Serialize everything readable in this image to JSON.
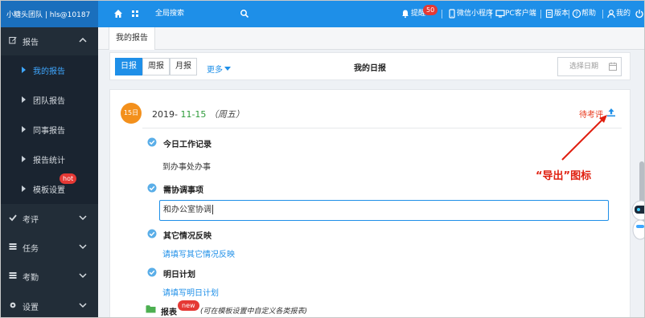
{
  "topbar": {
    "brand": "小糖头团队 | hls@10187",
    "search": "全局搜索",
    "remind": "提醒",
    "remind_count": "50",
    "miniprogram": "微信小程序",
    "pc_client": "PC客户端",
    "version": "版本",
    "help": "帮助",
    "mine": "我的"
  },
  "sidebar": {
    "report": "报告",
    "sub_items": [
      "我的报告",
      "团队报告",
      "同事报告",
      "报告统计",
      "模板设置"
    ],
    "hot": "hot",
    "review": "考评",
    "task": "任务",
    "attendance": "考勤",
    "settings": "设置"
  },
  "tabs": {
    "active": "我的报告"
  },
  "toolbar": {
    "daily": "日报",
    "weekly": "周报",
    "monthly": "月报",
    "more": "更多",
    "title": "我的日报",
    "date_placeholder": "选择日期"
  },
  "report": {
    "day_badge": "15日",
    "year": "2019-",
    "month_day": "11-15",
    "weekday": "（周五）",
    "status": "待考评",
    "today_work_title": "今日工作记录",
    "today_work_value": "到办事处办事",
    "coord_title": "需协调事项",
    "coord_value": "和办公室协调",
    "other_title": "其它情况反映",
    "other_placeholder": "请填写其它情况反映",
    "tomorrow_title": "明日计划",
    "tomorrow_placeholder": "请填写明日计划",
    "table_title": "报表",
    "new_badge": "new",
    "table_hint": "(可在模板设置中自定义各类报表)"
  },
  "annotation": {
    "text": "“导出”图标",
    "color": "#e02010"
  },
  "colors": {
    "accent": "#1e8fe8",
    "sidebar": "#222d38",
    "day_badge": "#f3901c"
  }
}
